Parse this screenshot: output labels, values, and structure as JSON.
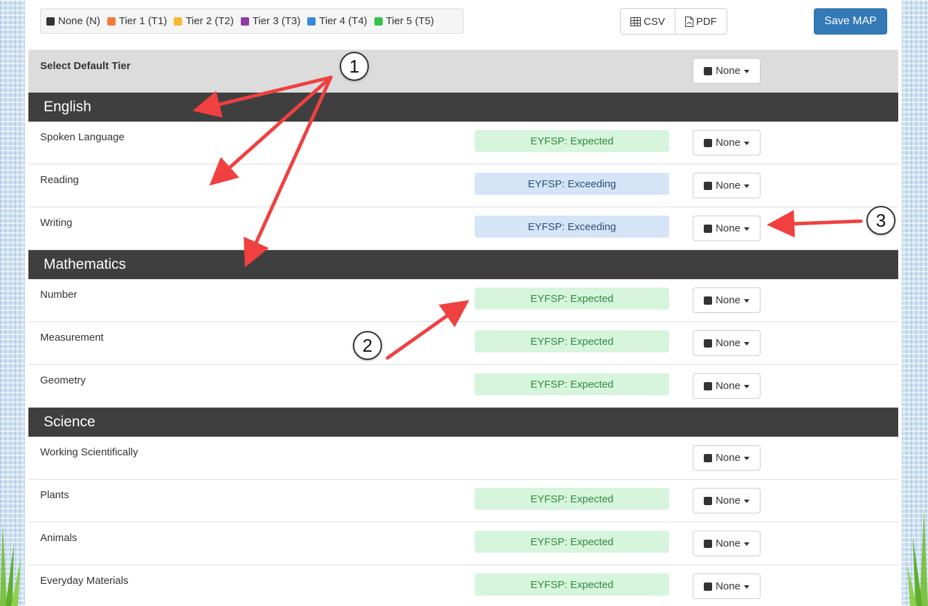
{
  "legend": [
    {
      "label": "None (N)",
      "color": "#333333"
    },
    {
      "label": "Tier 1 (T1)",
      "color": "#f47a3a"
    },
    {
      "label": "Tier 2 (T2)",
      "color": "#f8b830"
    },
    {
      "label": "Tier 3 (T3)",
      "color": "#8e3aa8"
    },
    {
      "label": "Tier 4 (T4)",
      "color": "#3a86d8"
    },
    {
      "label": "Tier 5 (T5)",
      "color": "#33c24d"
    }
  ],
  "toolbar": {
    "csv_label": "CSV",
    "pdf_label": "PDF",
    "save_label": "Save MAP"
  },
  "default_tier": {
    "label": "Select Default Tier",
    "value": "None"
  },
  "sections": [
    {
      "title": "English",
      "rows": [
        {
          "label": "Spoken Language",
          "status": "EYFSP: Expected",
          "status_type": "expected",
          "tier": "None"
        },
        {
          "label": "Reading",
          "status": "EYFSP: Exceeding",
          "status_type": "exceeding",
          "tier": "None"
        },
        {
          "label": "Writing",
          "status": "EYFSP: Exceeding",
          "status_type": "exceeding",
          "tier": "None"
        }
      ]
    },
    {
      "title": "Mathematics",
      "rows": [
        {
          "label": "Number",
          "status": "EYFSP: Expected",
          "status_type": "expected",
          "tier": "None"
        },
        {
          "label": "Measurement",
          "status": "EYFSP: Expected",
          "status_type": "expected",
          "tier": "None"
        },
        {
          "label": "Geometry",
          "status": "EYFSP: Expected",
          "status_type": "expected",
          "tier": "None"
        }
      ]
    },
    {
      "title": "Science",
      "rows": [
        {
          "label": "Working Scientifically",
          "status": "",
          "status_type": "none",
          "tier": "None"
        },
        {
          "label": "Plants",
          "status": "EYFSP: Expected",
          "status_type": "expected",
          "tier": "None"
        },
        {
          "label": "Animals",
          "status": "EYFSP: Expected",
          "status_type": "expected",
          "tier": "None"
        },
        {
          "label": "Everyday Materials",
          "status": "EYFSP: Expected",
          "status_type": "expected",
          "tier": "None"
        }
      ]
    }
  ],
  "callouts": {
    "one": "1",
    "two": "2",
    "three": "3"
  }
}
